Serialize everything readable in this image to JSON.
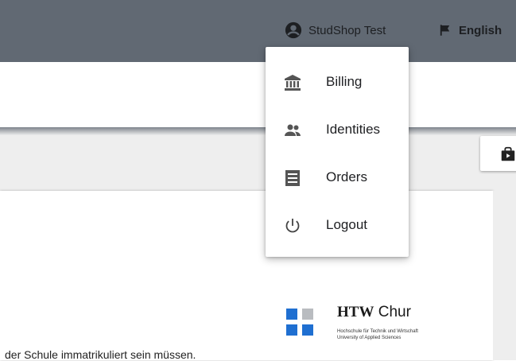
{
  "header": {
    "user_name": "StudShop Test",
    "language": "English"
  },
  "user_menu": {
    "items": [
      {
        "label": "Billing",
        "icon": "bank-icon"
      },
      {
        "label": "Identities",
        "icon": "people-icon"
      },
      {
        "label": "Orders",
        "icon": "list-icon"
      },
      {
        "label": "Logout",
        "icon": "power-icon"
      }
    ]
  },
  "content": {
    "footer_text": "der Schule immatrikuliert sein müssen."
  },
  "logo": {
    "name_bold": "HTW",
    "name_regular": "Chur",
    "line1": "Hochschule für Technik und Wirtschaft",
    "line2": "University of Applied Sciences"
  },
  "colors": {
    "topbar": "#616973",
    "logo_blue": "#1f6fd1",
    "logo_grey": "#b9bcc0"
  }
}
